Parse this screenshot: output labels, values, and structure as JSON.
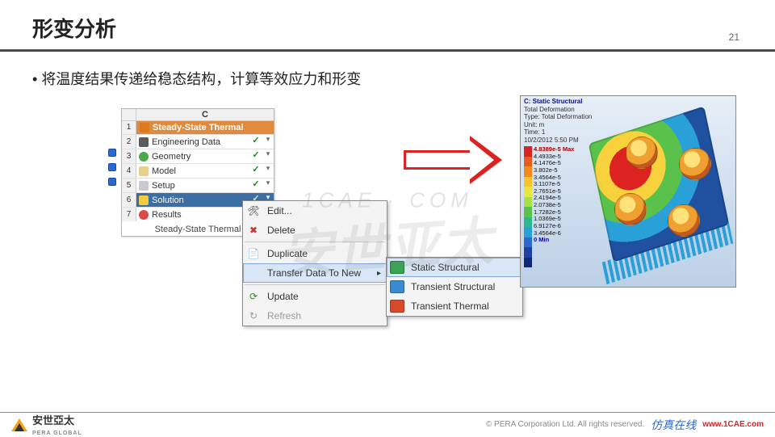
{
  "page": {
    "title": "形变分析",
    "number": "21"
  },
  "bullet": "将温度结果传递给稳态结构，计算等效应力和形变",
  "schematic": {
    "column_letter": "C",
    "system_title": "Steady-State Thermal",
    "rows": [
      {
        "n": "1",
        "label": "Steady-State Thermal"
      },
      {
        "n": "2",
        "label": "Engineering Data"
      },
      {
        "n": "3",
        "label": "Geometry"
      },
      {
        "n": "4",
        "label": "Model"
      },
      {
        "n": "5",
        "label": "Setup"
      },
      {
        "n": "6",
        "label": "Solution"
      },
      {
        "n": "7",
        "label": "Results"
      }
    ],
    "caption": "Steady-State Thermal"
  },
  "context_menu": {
    "items": [
      {
        "label": "Edit...",
        "icon": "🛠"
      },
      {
        "label": "Delete",
        "icon": "✖"
      },
      {
        "label": "Duplicate",
        "icon": "📄"
      },
      {
        "label": "Transfer Data To New",
        "icon": "",
        "submenu": true
      },
      {
        "label": "Update",
        "icon": "⟳"
      },
      {
        "label": "Refresh",
        "icon": "↻",
        "disabled": true
      }
    ]
  },
  "submenu": {
    "items": [
      {
        "label": "Static Structural"
      },
      {
        "label": "Transient Structural"
      },
      {
        "label": "Transient Thermal"
      }
    ]
  },
  "result": {
    "title": "C: Static Structural",
    "line2": "Total Deformation",
    "line3": "Type: Total Deformation",
    "line4": "Unit: m",
    "line5": "Time: 1",
    "line6": "10/2/2012 5:50 PM",
    "legend_max": "4.8389e-5 Max",
    "legend": [
      "4.4933e-5",
      "4.1476e-5",
      "3.802e-5",
      "3.4564e-5",
      "3.1107e-5",
      "2.7651e-5",
      "2.4194e-5",
      "2.0738e-5",
      "1.7282e-5",
      "1.0369e-5",
      "6.9127e-6",
      "3.4564e-6"
    ],
    "legend_min": "0 Min"
  },
  "watermark": {
    "big": "安世亚太",
    "small": "1CAE · COM"
  },
  "footer": {
    "logo_cn": "安世亞太",
    "logo_en": "PERA GLOBAL",
    "copyright": "©   PERA Corporation Ltd. All rights reserved.",
    "brand": "仿真在线",
    "url": "www.1CAE.com"
  }
}
